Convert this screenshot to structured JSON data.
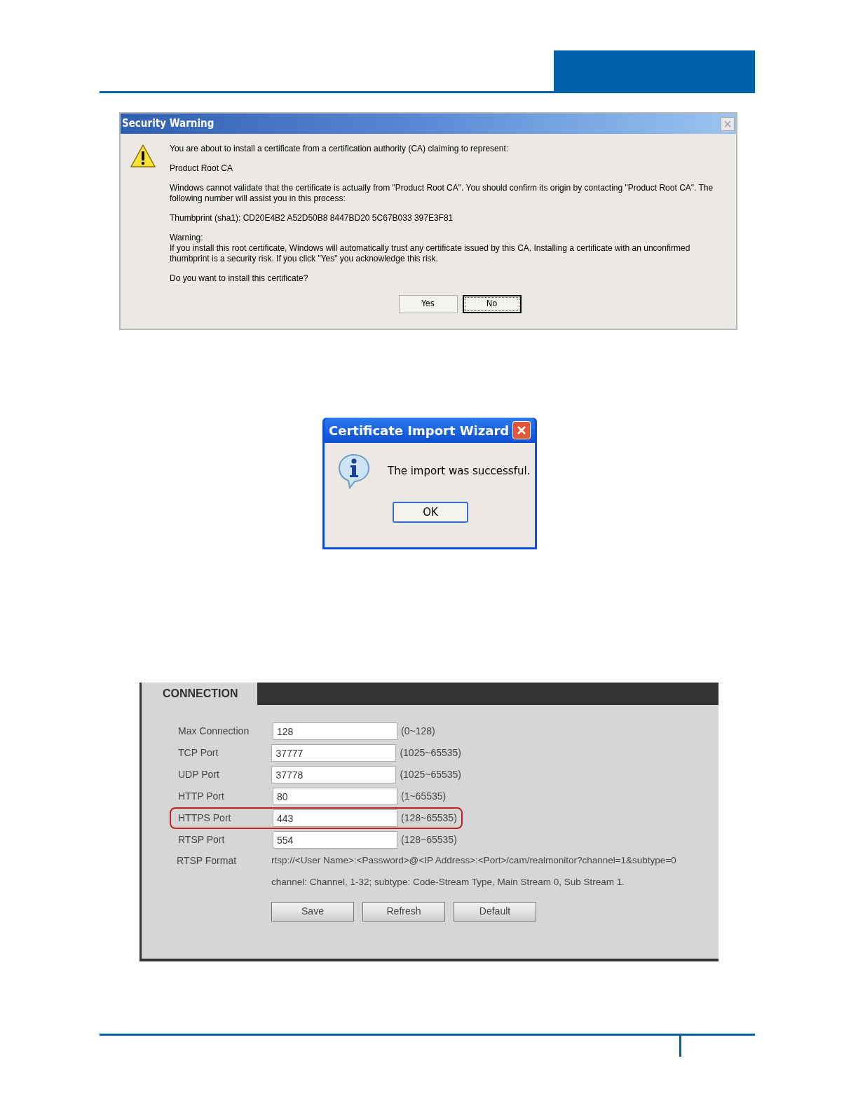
{
  "security_warning": {
    "title": "Security Warning",
    "paragraphs": [
      "You are about to install a certificate from a certification authority (CA) claiming to represent:",
      "Product Root CA",
      "Windows cannot validate that the certificate is actually from \"Product Root CA\". You should confirm its origin by contacting \"Product Root CA\". The following number will assist you in this process:",
      "Thumbprint (sha1): CD20E4B2 A52D50B8 8447BD20 5C67B033 397E3F81",
      "Warning:\nIf you install this root certificate, Windows will automatically trust any certificate issued by this CA. Installing a certificate with an unconfirmed thumbprint is a security risk. If you click \"Yes\" you acknowledge this risk.",
      "Do you want to install this certificate?"
    ],
    "buttons": [
      {
        "label": "Yes",
        "focused": false
      },
      {
        "label": "No",
        "focused": true
      }
    ]
  },
  "import_wizard": {
    "title": "Certificate Import Wizard",
    "message": "The import was successful.",
    "button": "OK"
  },
  "connection": {
    "tab": "CONNECTION",
    "rows": [
      {
        "label": "Max Connection",
        "value": "128",
        "range": "(0~128)",
        "highlighted": false
      },
      {
        "label": "TCP Port",
        "value": "37777",
        "range": "(1025~65535)",
        "highlighted": false
      },
      {
        "label": "UDP Port",
        "value": "37778",
        "range": "(1025~65535)",
        "highlighted": false
      },
      {
        "label": "HTTP Port",
        "value": "80",
        "range": "(1~65535)",
        "highlighted": false
      },
      {
        "label": "HTTPS Port",
        "value": "443",
        "range": "(128~65535)",
        "highlighted": true
      },
      {
        "label": "RTSP Port",
        "value": "554",
        "range": "(128~65535)",
        "highlighted": false
      }
    ],
    "rtsp_label": "RTSP Format",
    "rtsp_format": "rtsp://<User Name>:<Password>@<IP Address>:<Port>/cam/realmonitor?channel=1&subtype=0",
    "rtsp_note": "channel: Channel, 1-32; subtype: Code-Stream Type, Main Stream 0, Sub Stream 1.",
    "buttons": [
      "Save",
      "Refresh",
      "Default"
    ]
  }
}
